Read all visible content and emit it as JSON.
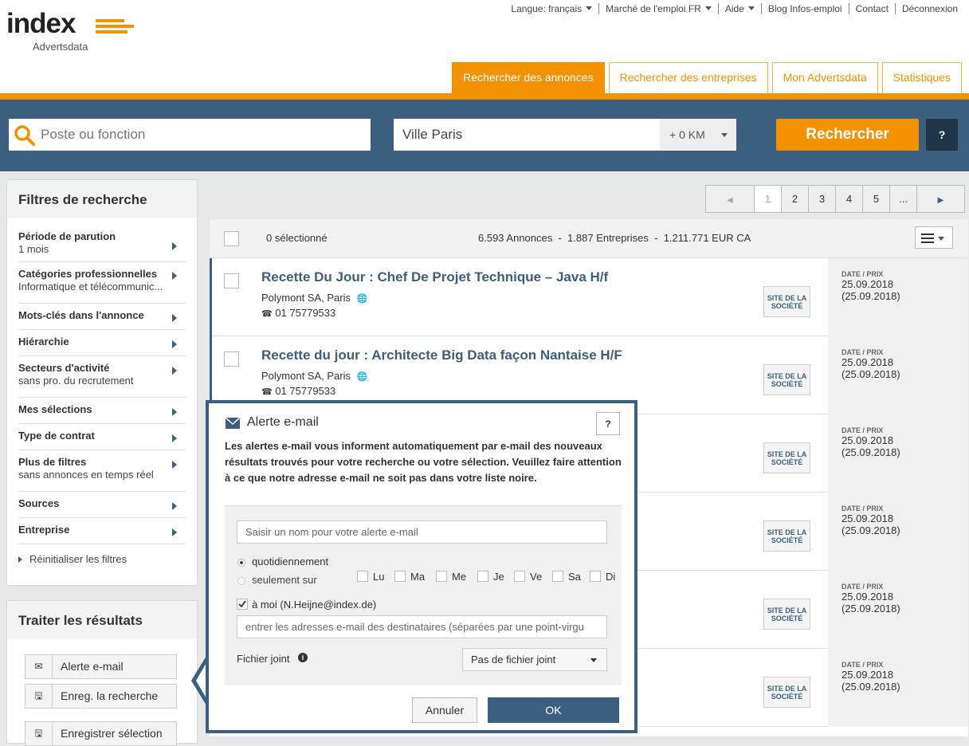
{
  "header": {
    "logo_text": "index",
    "logo_sub": "Advertsdata",
    "topnav": [
      {
        "label": "Langue: français",
        "dropdown": true
      },
      {
        "label": "Marché de l'emploi FR",
        "dropdown": true
      },
      {
        "label": "Aide",
        "dropdown": true
      },
      {
        "label": "Blog Infos-emploi",
        "dropdown": false
      },
      {
        "label": "Contact",
        "dropdown": false
      },
      {
        "label": "Déconnexion",
        "dropdown": false
      }
    ],
    "tabs": [
      "Rechercher des annonces",
      "Rechercher des entreprises",
      "Mon Advertsdata",
      "Statistiques"
    ]
  },
  "search": {
    "job_placeholder": "Poste ou fonction",
    "city_value": "Ville Paris",
    "radius": "+ 0 KM",
    "button": "Rechercher",
    "help": "?"
  },
  "filters": {
    "title": "Filtres de recherche",
    "items": [
      {
        "title": "Période de parution",
        "sub": "1 mois"
      },
      {
        "title": "Catégories professionnelles",
        "sub": "Informatique et télécommunic..."
      },
      {
        "title": "Mots-clés dans l'annonce",
        "sub": ""
      },
      {
        "title": "Hiérarchie",
        "sub": ""
      },
      {
        "title": "Secteurs d'activité",
        "sub": "sans pro. du recrutement"
      },
      {
        "title": "Mes sélections",
        "sub": ""
      },
      {
        "title": "Type de contrat",
        "sub": ""
      },
      {
        "title": "Plus de filtres",
        "sub": "sans annonces en temps réel"
      },
      {
        "title": "Sources",
        "sub": ""
      },
      {
        "title": "Entreprise",
        "sub": ""
      }
    ],
    "reset": "Réinitialiser les filtres"
  },
  "process": {
    "title": "Traiter les résultats",
    "buttons": [
      {
        "label": "Alerte e-mail",
        "icon": "envelope-icon"
      },
      {
        "label": "Enreg. la recherche",
        "icon": "save-icon"
      },
      {
        "label": "Enregistrer sélection",
        "icon": "save-icon"
      }
    ]
  },
  "pager": {
    "pages": [
      "1",
      "2",
      "3",
      "4",
      "5",
      "..."
    ]
  },
  "results": {
    "selected": "0 sélectionné",
    "summary": "6.593 Annonces  -  1.887 Entreprises  -  1.211.771 EUR CA",
    "date_label": "DATE / PRIX",
    "badge": "SITE DE LA SOCIÉTÉ",
    "listings": [
      {
        "title": "Recette Du Jour : Chef De Projet Technique – Java H/f",
        "company": "Polymont SA, Paris",
        "phone": "01 75779533",
        "date": "25.09.2018",
        "date2": "(25.09.2018)"
      },
      {
        "title": "Recette du jour : Architecte Big Data façon Nantaise H/F",
        "company": "Polymont SA, Paris",
        "phone": "01 75779533",
        "date": "25.09.2018",
        "date2": "(25.09.2018)"
      },
      {
        "title": "",
        "company": "",
        "phone": "",
        "date": "25.09.2018",
        "date2": "(25.09.2018)"
      },
      {
        "title": "",
        "company": "",
        "phone": "",
        "date": "25.09.2018",
        "date2": "(25.09.2018)"
      },
      {
        "title": "",
        "company": "",
        "phone": "",
        "date": "25.09.2018",
        "date2": "(25.09.2018)"
      },
      {
        "title": "",
        "company": "",
        "phone": "",
        "date": "25.09.2018",
        "date2": "(25.09.2018)"
      }
    ]
  },
  "modal": {
    "title": "Alerte e-mail",
    "help": "?",
    "description": "Les alertes e-mail vous informent automatiquement par e-mail des nouveaux résultats trouvés pour votre recherche ou votre sélection. Veuillez faire attention à ce que notre adresse e-mail ne soit pas dans votre liste noire.",
    "name_placeholder": "Saisir un nom pour votre alerte e-mail",
    "freq_daily": "quotidiennement",
    "freq_only": "seulement sur",
    "days": [
      "Lu",
      "Ma",
      "Me",
      "Je",
      "Ve",
      "Sa",
      "Di"
    ],
    "to_me": "à moi (N.Heijne@index.de)",
    "recipients_placeholder": "entrer les adresses e-mail des destinataires (séparées par une point-virgu",
    "attachment_label": "Fichier joint",
    "attachment_value": "Pas de fichier joint",
    "cancel": "Annuler",
    "ok": "OK"
  }
}
